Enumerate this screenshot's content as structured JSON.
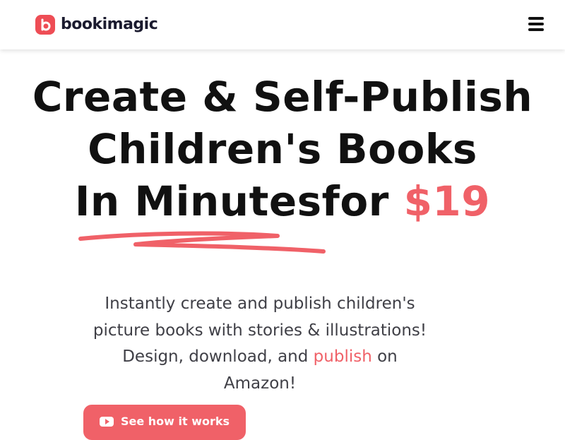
{
  "header": {
    "logo_text": "bookimagic",
    "logo_icon": "b-letter-icon",
    "menu_icon": "hamburger-menu-icon"
  },
  "hero": {
    "title_line1": "Create & Self-Publish",
    "title_line2": "Children's Books",
    "title_line3_prefix": "In Minutesfor ",
    "title_price": "$19",
    "subtitle_line1": "Instantly create and publish children's",
    "subtitle_line2": "picture books with stories & illustrations!",
    "subtitle_line3_prefix": "Design, download, and ",
    "subtitle_link": "publish",
    "subtitle_line3_suffix": " on",
    "subtitle_line4": "Amazon!"
  },
  "cta": {
    "label": "See how it works",
    "icon": "play-icon"
  },
  "colors": {
    "accent": "#f06168",
    "logo_badge": "#ee4d55",
    "text_dark": "#111111",
    "text_body": "#3f3f46"
  }
}
